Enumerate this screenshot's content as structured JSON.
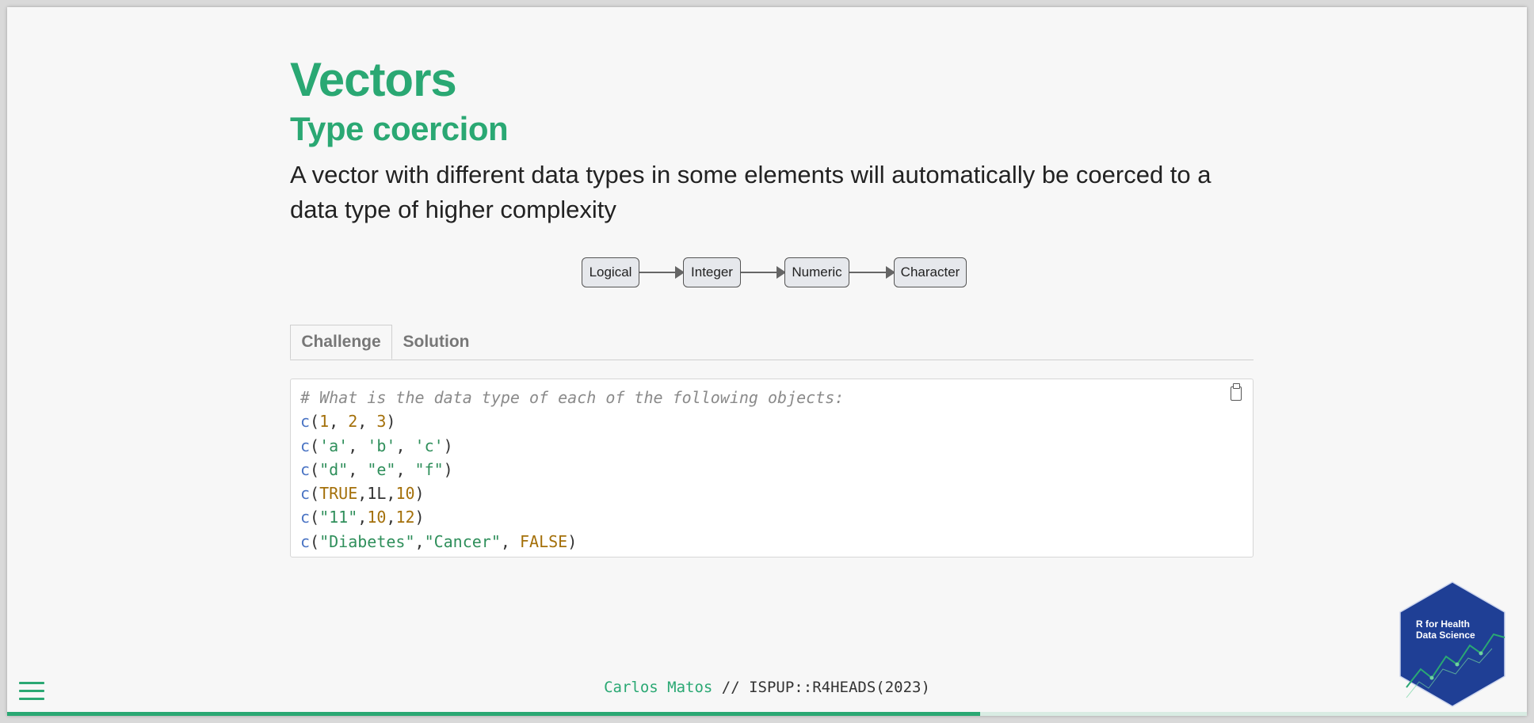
{
  "slide": {
    "title": "Vectors",
    "subtitle": "Type coercion",
    "paragraph": "A vector with different data types in some elements will automatically be coerced to a data type of higher complexity"
  },
  "diagram": {
    "nodes": [
      "Logical",
      "Integer",
      "Numeric",
      "Character"
    ]
  },
  "tabs": [
    {
      "label": "Challenge",
      "active": true
    },
    {
      "label": "Solution",
      "active": false
    }
  ],
  "code": {
    "lines": [
      "# What is the data type of each of the following objects:",
      "c(1, 2, 3)",
      "c('a', 'b', 'c')",
      "c(\"d\", \"e\", \"f\")",
      "c(TRUE,1L,10)",
      "c(\"11\",10,12)",
      "c(\"Diabetes\",\"Cancer\", FALSE)"
    ],
    "copy_icon": "clipboard-icon"
  },
  "footer": {
    "author": "Carlos Matos",
    "suffix": " // ISPUP::R4HEADS(2023)"
  },
  "logo": {
    "line1": "R for Health",
    "line2": "Data Science",
    "colors": {
      "fill": "#1f3f95",
      "accent": "#2aa873"
    }
  },
  "menu_icon": "hamburger-menu-icon",
  "progress": {
    "fraction": 0.64
  },
  "colors": {
    "accent": "#2aa873",
    "text": "#222222"
  }
}
